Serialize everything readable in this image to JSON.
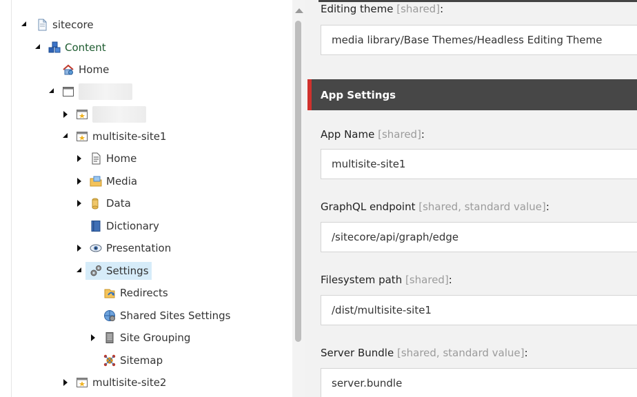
{
  "tree": {
    "nodes": [
      {
        "id": "sitecore",
        "label": "sitecore",
        "icon": "document-icon",
        "toggle": "open"
      },
      {
        "id": "content",
        "label": "Content",
        "icon": "cubes-icon",
        "toggle": "open"
      },
      {
        "id": "home",
        "label": "Home",
        "icon": "home-icon",
        "toggle": "none"
      },
      {
        "id": "redacted-1",
        "label": "",
        "icon": "window-icon",
        "toggle": "open"
      },
      {
        "id": "redacted-2",
        "label": "",
        "icon": "site-icon",
        "toggle": "closed"
      },
      {
        "id": "multisite-site1",
        "label": "multisite-site1",
        "icon": "site-icon",
        "toggle": "open"
      },
      {
        "id": "site1-home",
        "label": "Home",
        "icon": "page-icon",
        "toggle": "closed"
      },
      {
        "id": "media",
        "label": "Media",
        "icon": "media-folder-icon",
        "toggle": "closed"
      },
      {
        "id": "data",
        "label": "Data",
        "icon": "database-icon",
        "toggle": "closed"
      },
      {
        "id": "dictionary",
        "label": "Dictionary",
        "icon": "book-icon",
        "toggle": "none"
      },
      {
        "id": "presentation",
        "label": "Presentation",
        "icon": "eye-icon",
        "toggle": "closed"
      },
      {
        "id": "settings",
        "label": "Settings",
        "icon": "gears-icon",
        "toggle": "open",
        "selected": true
      },
      {
        "id": "redirects",
        "label": "Redirects",
        "icon": "redirect-icon",
        "toggle": "none"
      },
      {
        "id": "shared-sites-settings",
        "label": "Shared Sites Settings",
        "icon": "globe-gear-icon",
        "toggle": "none"
      },
      {
        "id": "site-grouping",
        "label": "Site Grouping",
        "icon": "server-icon",
        "toggle": "closed"
      },
      {
        "id": "sitemap",
        "label": "Sitemap",
        "icon": "sitemap-icon",
        "toggle": "none"
      },
      {
        "id": "multisite-site2",
        "label": "multisite-site2",
        "icon": "site-icon",
        "toggle": "closed"
      }
    ]
  },
  "content": {
    "editing_theme": {
      "label": "Editing theme",
      "meta": "[shared]",
      "value": "media library/Base Themes/Headless Editing Theme"
    },
    "section_title": "App Settings",
    "app_name": {
      "label": "App Name",
      "meta": "[shared]",
      "value": "multisite-site1"
    },
    "graphql_endpoint": {
      "label": "GraphQL endpoint",
      "meta": "[shared, standard value]",
      "value": "/sitecore/api/graph/edge"
    },
    "filesystem_path": {
      "label": "Filesystem path",
      "meta": "[shared]",
      "value": "/dist/multisite-site1"
    },
    "server_bundle": {
      "label": "Server Bundle",
      "meta": "[shared, standard value]",
      "value": "server.bundle"
    }
  },
  "colors": {
    "selected_bg": "#d6ecf9",
    "section_header_bg": "#474747",
    "section_accent": "#d0312d",
    "content_label_green": "#1d5b2f"
  }
}
